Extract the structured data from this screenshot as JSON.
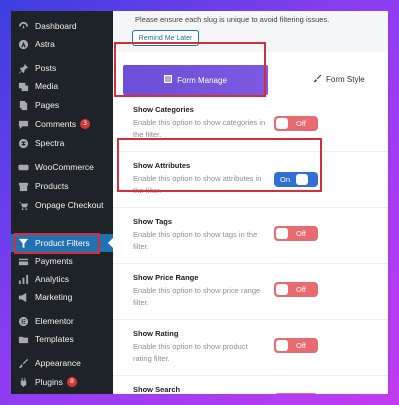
{
  "sidebar": {
    "items": [
      {
        "label": "Dashboard",
        "icon": "dashboard-icon"
      },
      {
        "label": "Astra",
        "icon": "astra-icon"
      },
      {
        "label": "Posts",
        "icon": "pin-icon"
      },
      {
        "label": "Media",
        "icon": "media-icon"
      },
      {
        "label": "Pages",
        "icon": "page-icon"
      },
      {
        "label": "Comments",
        "icon": "comment-icon",
        "badge": "3"
      },
      {
        "label": "Spectra",
        "icon": "spectra-icon"
      },
      {
        "label": "WooCommerce",
        "icon": "woo-icon"
      },
      {
        "label": "Products",
        "icon": "archive-icon"
      },
      {
        "label": "Onpage Checkout",
        "icon": "cart-icon"
      },
      {
        "label": "Product Filters",
        "icon": "filter-icon",
        "active": true
      },
      {
        "label": "Payments",
        "icon": "payments-icon"
      },
      {
        "label": "Analytics",
        "icon": "chart-icon"
      },
      {
        "label": "Marketing",
        "icon": "megaphone-icon"
      },
      {
        "label": "Elementor",
        "icon": "elementor-icon"
      },
      {
        "label": "Templates",
        "icon": "folder-icon"
      },
      {
        "label": "Appearance",
        "icon": "brush-icon"
      },
      {
        "label": "Plugins",
        "icon": "plug-icon",
        "badge": "8"
      }
    ]
  },
  "notice": {
    "text": "Please ensure each slug is unique to avoid filtering issues.",
    "remind_label": "Remind Me Later"
  },
  "tabs": {
    "form_manage": "Form Manage",
    "form_style": "Form Style"
  },
  "settings": [
    {
      "title": "Show Categories",
      "desc": "Enable this option to show categories in the filter.",
      "state": "Off"
    },
    {
      "title": "Show Attributes",
      "desc": "Enable this option to show attributes in the filter.",
      "state": "On"
    },
    {
      "title": "Show Tags",
      "desc": "Enable this option to show tags in the filter.",
      "state": "Off"
    },
    {
      "title": "Show Price Range",
      "desc": "Enable this option to show price range filter.",
      "state": "Off"
    },
    {
      "title": "Show Rating",
      "desc": "Enable this option to show product rating filter.",
      "state": "Off"
    },
    {
      "title": "Show Search",
      "desc": "",
      "state": "Off"
    }
  ],
  "colors": {
    "sidebar_bg": "#1d2327",
    "active_blue": "#2271b1",
    "highlight_red": "#d42f3a",
    "toggle_off": "#e86b72",
    "toggle_on": "#2f6fd6",
    "tab_purple": "#6a4fd8"
  }
}
